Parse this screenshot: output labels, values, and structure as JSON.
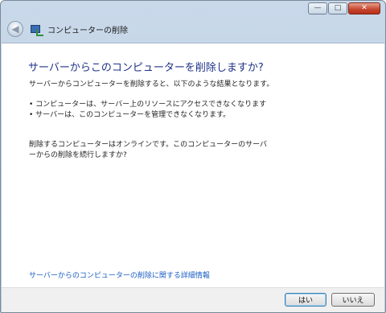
{
  "titlebar": {
    "minimize_glyph": "—",
    "maximize_glyph": "□",
    "close_glyph": "✕"
  },
  "nav": {
    "back_glyph": "◀",
    "title": "コンピューターの削除",
    "icon": "network-computer-icon"
  },
  "main": {
    "heading": "サーバーからこのコンピューターを削除しますか?",
    "intro": "サーバーからコンピューターを削除すると、以下のような結果となります。",
    "bullets": [
      "• コンピューターは、サーバー上のリソースにアクセスできなくなります",
      "• サーバーは、このコンピューターを管理できなくなります。"
    ],
    "status_line1": "削除するコンピューターはオンラインです。このコンピューターのサーバ",
    "status_line2": "ーからの削除を続行しますか?",
    "link": "サーバーからのコンピューターの削除に関する詳細情報"
  },
  "buttons": {
    "yes": "はい",
    "no": "いいえ"
  }
}
